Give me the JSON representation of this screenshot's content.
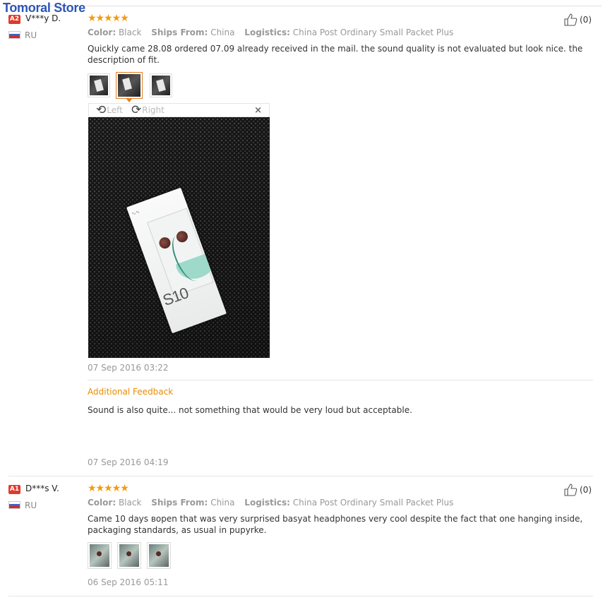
{
  "store": {
    "name": "Tomoral Store"
  },
  "reviews": [
    {
      "badge": "A2",
      "user": "V***y D.",
      "country": "RU",
      "stars": "★★★★★",
      "likes": "(0)",
      "meta": {
        "color_label": "Color:",
        "color_value": "Black",
        "ships_label": "Ships From:",
        "ships_value": "China",
        "logistics_label": "Logistics:",
        "logistics_value": "China Post Ordinary Small Packet Plus"
      },
      "text": "Quickly came 28.08 ordered 07.09 already received in the mail. the sound quality is not evaluated but look nice. the description of fit.",
      "viewer": {
        "left_label": "Left",
        "right_label": "Right",
        "close": "×",
        "product_text": "S10"
      },
      "date": "07 Sep 2016 03:22",
      "additional_title": "Additional Feedback",
      "additional_text": "Sound is also quite... not something that would be very loud but acceptable.",
      "additional_date": "07 Sep 2016 04:19"
    },
    {
      "badge": "A1",
      "user": "D***s V.",
      "country": "RU",
      "stars": "★★★★★",
      "likes": "(0)",
      "meta": {
        "color_label": "Color:",
        "color_value": "Black",
        "ships_label": "Ships From:",
        "ships_value": "China",
        "logistics_label": "Logistics:",
        "logistics_value": "China Post Ordinary Small Packet Plus"
      },
      "text": "Came 10 days вopen that was very surprised basyat headphones very cool despite the fact that one hanging inside, packaging standards, as usual in pupyrke.",
      "date": "06 Sep 2016 05:11"
    }
  ]
}
